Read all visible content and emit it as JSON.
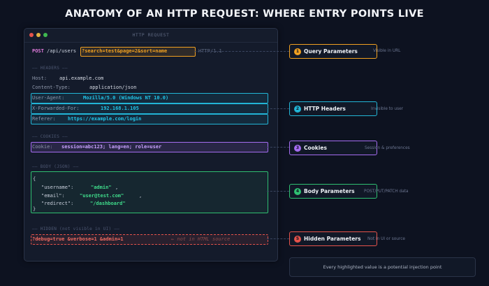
{
  "title": "ANATOMY OF AN HTTP REQUEST: WHERE ENTRY POINTS LIVE",
  "window": {
    "title": "HTTP REQUEST",
    "dots": [
      "#e5534b",
      "#e0b341",
      "#3fb950"
    ]
  },
  "request_line": {
    "method": "POST",
    "path": "/api/users",
    "query": "?search=test&page=2&sort=name",
    "version": "HTTP/1.1"
  },
  "headers": {
    "section": "—— HEADERS ——",
    "host": {
      "key": "Host:",
      "value": "api.example.com"
    },
    "content_type": {
      "key": "Content-Type:",
      "value": "application/json"
    },
    "user_agent": {
      "key": "User-Agent:",
      "value": "Mozilla/5.0 (Windows NT 10.0)"
    },
    "x_forwarded_for": {
      "key": "X-Forwarded-For:",
      "value": "192.168.1.105"
    },
    "referer": {
      "key": "Referer:",
      "value": "https://example.com/login"
    }
  },
  "cookies": {
    "section": "—— COOKIES ——",
    "key": "Cookie:",
    "value": "session=abc123; lang=en; role=user"
  },
  "body": {
    "section": "—— BODY (JSON) ——",
    "open": "{",
    "close": "}",
    "fields": [
      {
        "key": "\"username\":",
        "value": "\"admin\"",
        "suffix": ","
      },
      {
        "key": "\"email\":",
        "value": "\"user@test.com\"",
        "suffix": ","
      },
      {
        "key": "\"redirect\":",
        "value": "\"/dashboard\"",
        "suffix": ""
      }
    ]
  },
  "hidden": {
    "section": "—— HIDDEN (not visible in UI) ——",
    "params": "?debug=true &verbose=1 &admin=1",
    "note": "← not in HTML source"
  },
  "legend": [
    {
      "number": "1",
      "label": "Query Parameters",
      "note": "Visible in URL",
      "color": "#f0a020"
    },
    {
      "number": "2",
      "label": "HTTP Headers",
      "note": "Invisible to user",
      "color": "#22b5d6"
    },
    {
      "number": "3",
      "label": "Cookies",
      "note": "Session & preferences",
      "color": "#a46cf0"
    },
    {
      "number": "4",
      "label": "Body Parameters",
      "note": "POST/PUT/PATCH data",
      "color": "#2fbf71"
    },
    {
      "number": "5",
      "label": "Hidden Parameters",
      "note": "Not in UI or source",
      "color": "#e5534b"
    }
  ],
  "footer": "Every highlighted value is a potential injection point"
}
